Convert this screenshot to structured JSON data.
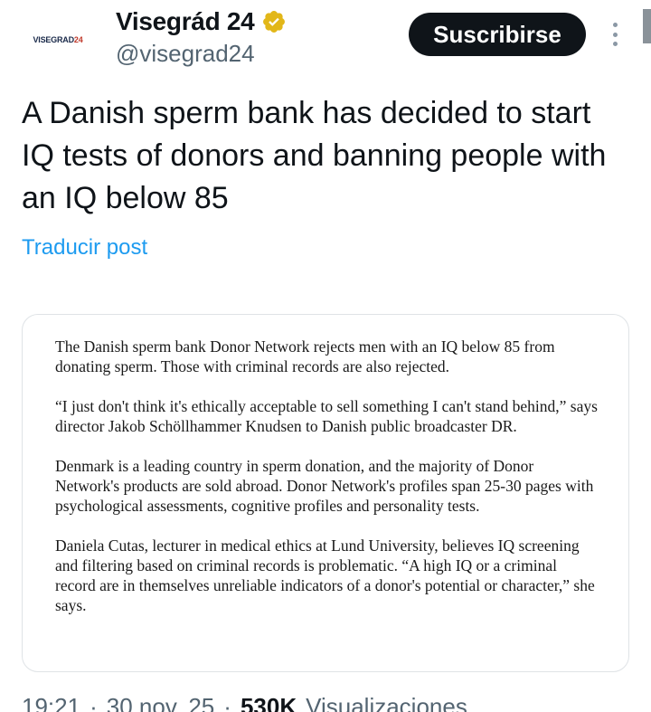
{
  "header": {
    "avatar_text_a": "VISEGRAD",
    "avatar_text_b": "24",
    "display_name": "Visegrád 24",
    "handle": "@visegrad24",
    "subscribe_label": "Suscribirse",
    "verified_color": "#e2b719"
  },
  "tweet": {
    "text": "A Danish sperm bank has decided to start IQ tests of donors and banning people with an IQ below 85",
    "translate_label": "Traducir post"
  },
  "media": {
    "paragraphs": [
      "The Danish sperm bank Donor Network rejects men with an IQ below 85 from donating sperm. Those with criminal records are also rejected.",
      "“I just don't think it's ethically acceptable to sell something I can't stand behind,” says director Jakob Schöllhammer Knudsen to Danish public broadcaster DR.",
      "Denmark is a leading country in sperm donation, and the majority of Donor Network's products are sold abroad. Donor Network's profiles span 25-30 pages with psychological assessments, cognitive profiles and personality tests.",
      "Daniela Cutas, lecturer in medical ethics at Lund University, believes IQ screening and filtering based on criminal records is problematic. “A high IQ or a criminal record are in themselves unreliable indicators of a donor's potential or character,” she says."
    ]
  },
  "meta": {
    "time": "19:21",
    "separator": "·",
    "date": "30 nov. 25",
    "separator2": "·",
    "views": "530K",
    "views_label": "Visualizaciones"
  },
  "colors": {
    "link": "#1d9bf0",
    "button_bg": "#0f1419",
    "muted": "#536471"
  }
}
